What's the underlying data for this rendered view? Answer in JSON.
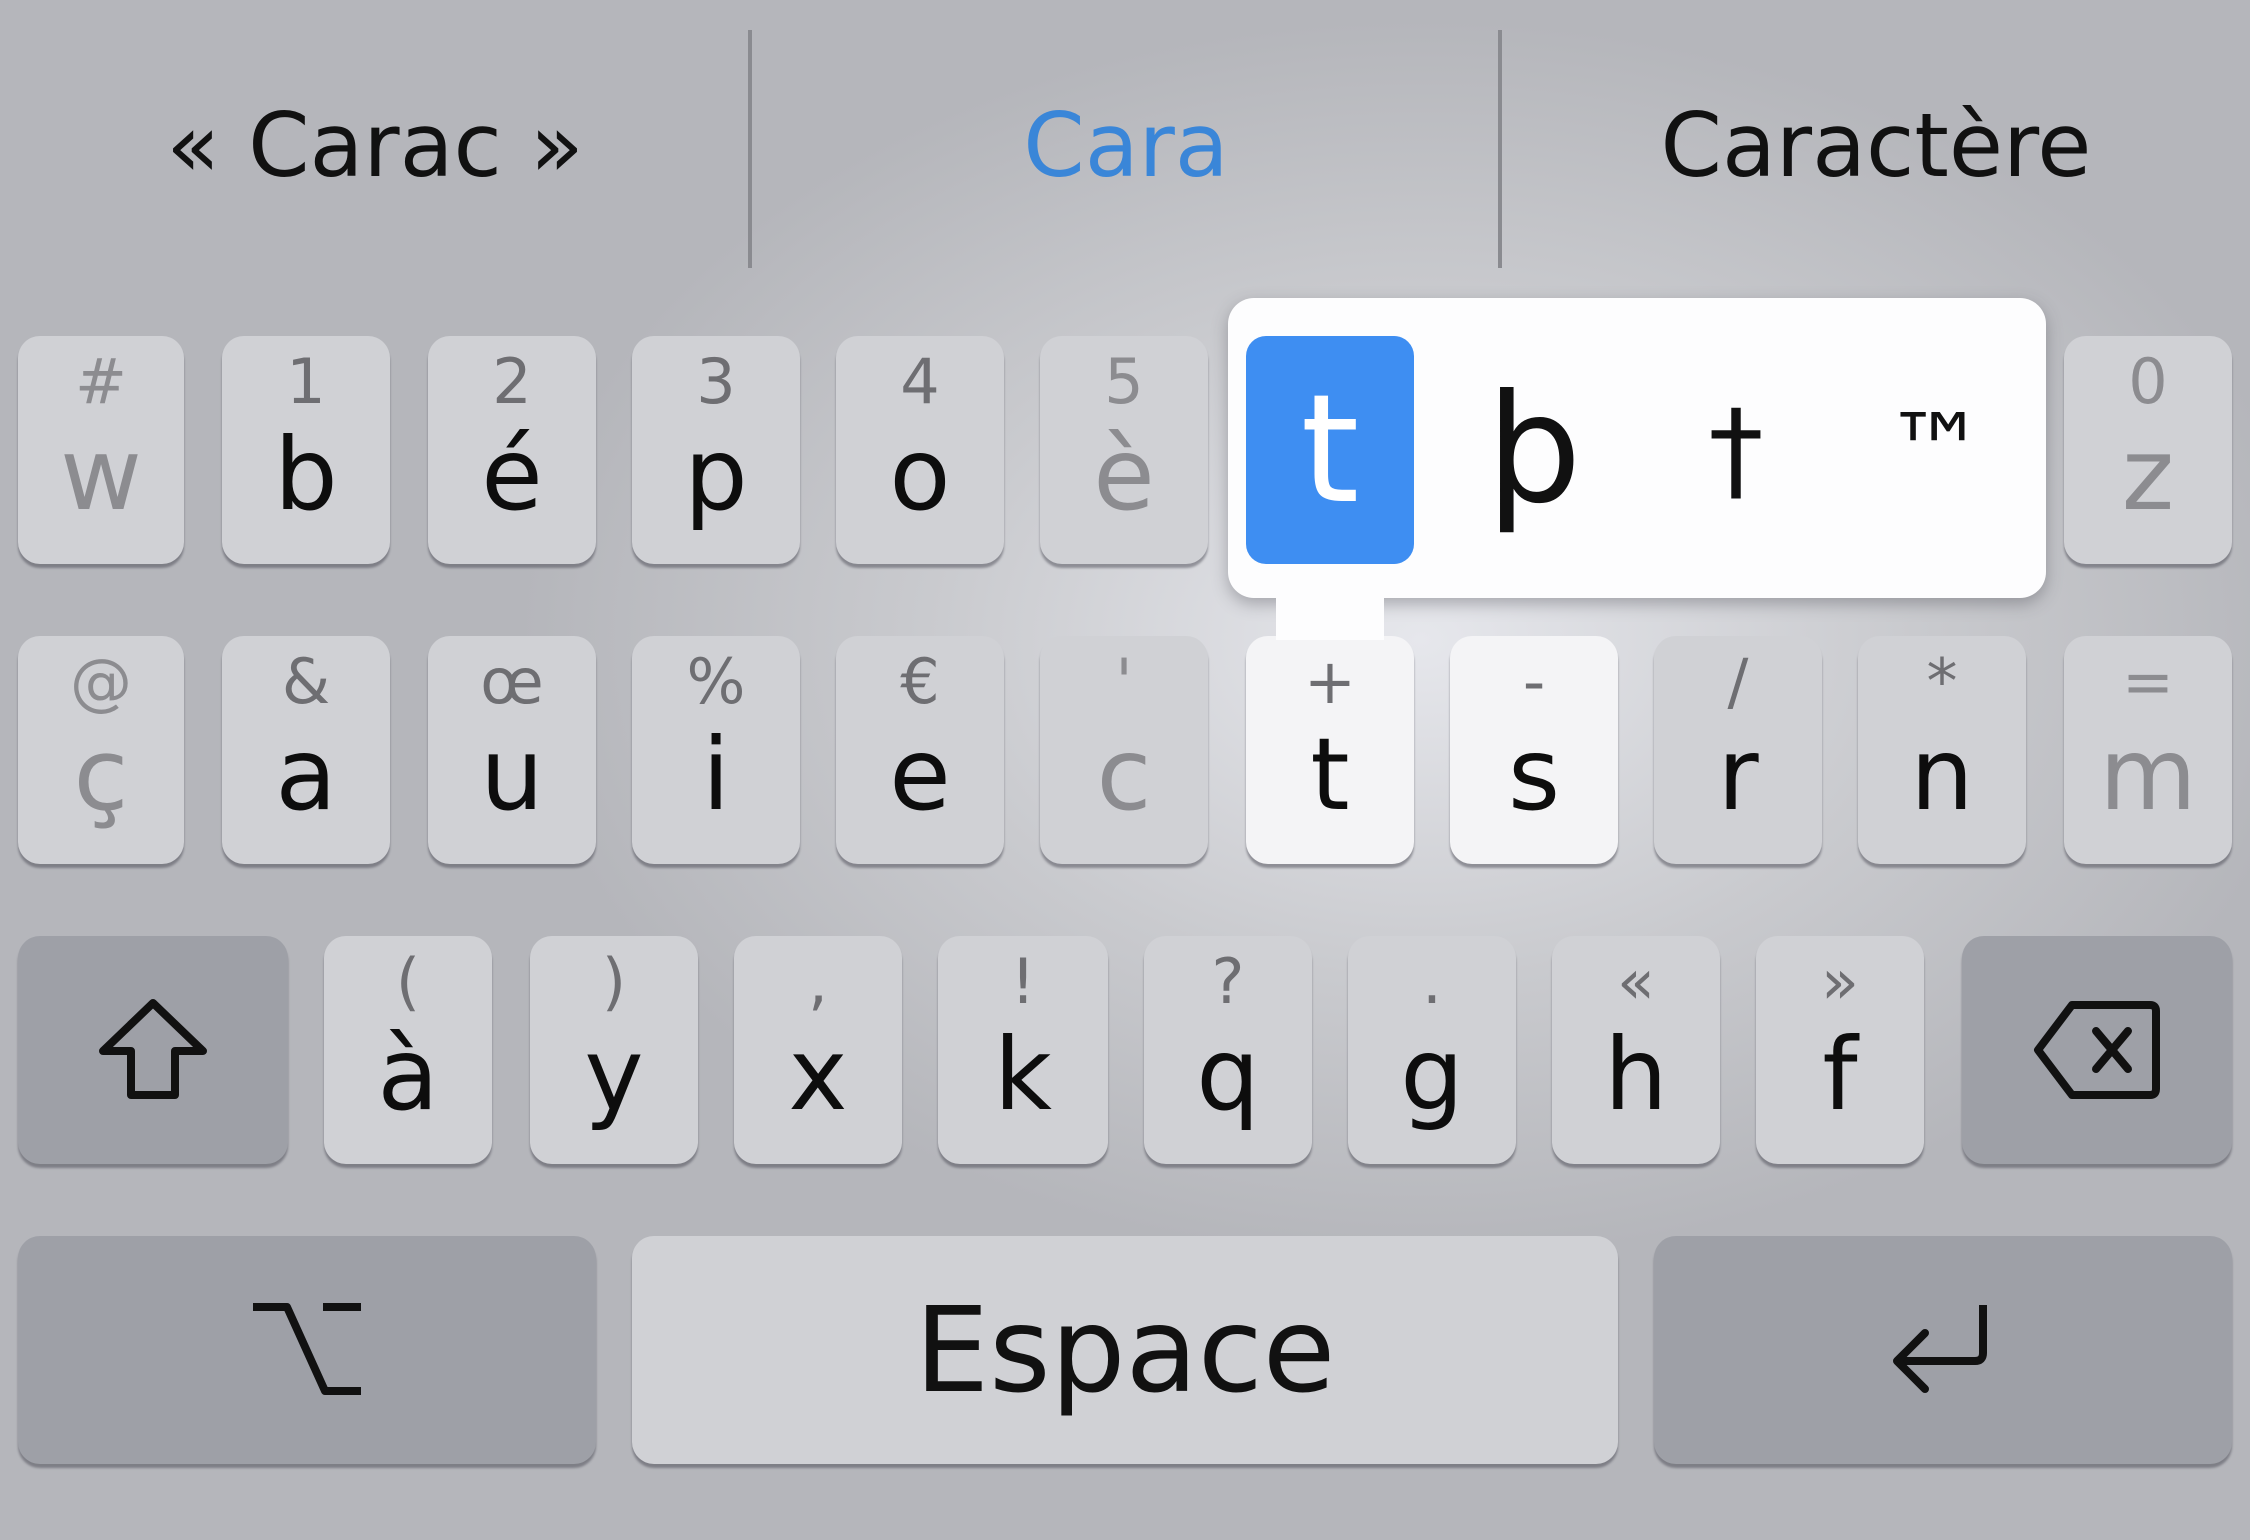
{
  "suggestions": [
    "« Carac »",
    "Cara",
    "Caractère"
  ],
  "colors": {
    "suggestion_accent": "#3a86d8",
    "popup_selected": "#3e8ef2",
    "key_background": "#d0d1d5",
    "function_key_background": "#9ea0a7"
  },
  "rows": {
    "row1": [
      {
        "secondary": "#",
        "primary": "w"
      },
      {
        "secondary": "1",
        "primary": "b"
      },
      {
        "secondary": "2",
        "primary": "é"
      },
      {
        "secondary": "3",
        "primary": "p"
      },
      {
        "secondary": "4",
        "primary": "o"
      },
      {
        "secondary": "5",
        "primary": "è"
      },
      {
        "secondary": "0",
        "primary": "z"
      }
    ],
    "row2": [
      {
        "secondary": "@",
        "primary": "ç"
      },
      {
        "secondary": "&",
        "primary": "a"
      },
      {
        "secondary": "œ",
        "primary": "u"
      },
      {
        "secondary": "%",
        "primary": "i"
      },
      {
        "secondary": "€",
        "primary": "e"
      },
      {
        "secondary": "'",
        "primary": "c"
      },
      {
        "secondary": "+",
        "primary": "t"
      },
      {
        "secondary": "-",
        "primary": "s"
      },
      {
        "secondary": "/",
        "primary": "r"
      },
      {
        "secondary": "*",
        "primary": "n"
      },
      {
        "secondary": "=",
        "primary": "m"
      }
    ],
    "row3": [
      {
        "secondary": "(",
        "primary": "à"
      },
      {
        "secondary": ")",
        "primary": "y"
      },
      {
        "secondary": ",",
        "primary": "x"
      },
      {
        "secondary": "!",
        "primary": "k"
      },
      {
        "secondary": "?",
        "primary": "q"
      },
      {
        "secondary": ".",
        "primary": "g"
      },
      {
        "secondary": "«",
        "primary": "h"
      },
      {
        "secondary": "»",
        "primary": "f"
      }
    ]
  },
  "popup": {
    "variants": [
      "t",
      "þ",
      "†",
      "™"
    ]
  },
  "bottom": {
    "space_label": "Espace"
  },
  "icons": {
    "shift": "shift-icon",
    "delete": "delete-icon",
    "option": "option-icon",
    "return": "return-icon"
  }
}
